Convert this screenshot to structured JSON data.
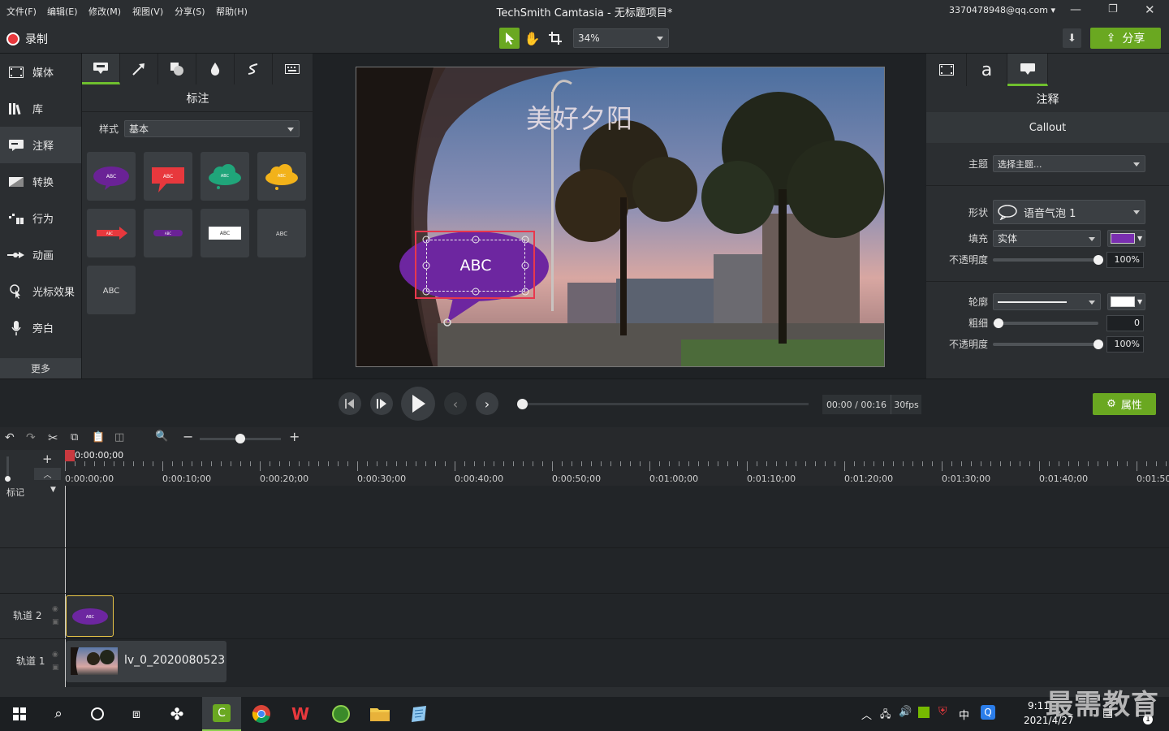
{
  "menubar": {
    "items": [
      "文件(F)",
      "编辑(E)",
      "修改(M)",
      "视图(V)",
      "分享(S)",
      "帮助(H)"
    ],
    "title": "TechSmith Camtasia - 无标题项目*",
    "account": "3370478948@qq.com"
  },
  "toolbar": {
    "record_label": "录制",
    "zoom": "34%",
    "share_label": "分享"
  },
  "leftnav": {
    "items": [
      {
        "label": "媒体",
        "icon": "film-icon"
      },
      {
        "label": "库",
        "icon": "library-icon"
      },
      {
        "label": "注释",
        "icon": "annotation-icon"
      },
      {
        "label": "转换",
        "icon": "transition-icon"
      },
      {
        "label": "行为",
        "icon": "behavior-icon"
      },
      {
        "label": "动画",
        "icon": "animation-icon"
      },
      {
        "label": "光标效果",
        "icon": "cursor-effect-icon"
      },
      {
        "label": "旁白",
        "icon": "microphone-icon"
      }
    ],
    "more_label": "更多"
  },
  "panel": {
    "title": "标注",
    "style_label": "样式",
    "style_value": "基本",
    "tile_text": "ABC"
  },
  "preview": {
    "overlay_text": "美好夕阳",
    "callout_text": "ABC"
  },
  "rightpanel": {
    "title": "注释",
    "subtitle": "Callout",
    "theme_label": "主题",
    "theme_value": "选择主题...",
    "shape_label": "形状",
    "shape_value": "语音气泡 1",
    "fill_label": "填充",
    "fill_value": "实体",
    "fill_color": "#7a2fb0",
    "opacity_label": "不透明度",
    "opacity_value": "100%",
    "opacity_level": 1.0,
    "outline_label": "轮廓",
    "outline_color": "#ffffff",
    "thickness_label": "粗细",
    "thickness_value": "0",
    "outline_opacity_label": "不透明度",
    "outline_opacity_value": "100%",
    "outline_opacity_level": 1.0
  },
  "transport": {
    "time": "00:00 / 00:16",
    "fps": "30fps",
    "properties_label": "属性"
  },
  "timeline": {
    "playhead": "0:00:00;00",
    "ticks": [
      "0:00:00;00",
      "0:00:10;00",
      "0:00:20;00",
      "0:00:30;00",
      "0:00:40;00",
      "0:00:50;00",
      "0:01:00;00",
      "0:01:10;00",
      "0:01:20;00",
      "0:01:30;00",
      "0:01:40;00",
      "0:01:50;"
    ],
    "marker_label": "标记",
    "track2_label": "轨道 2",
    "track1_label": "轨道 1",
    "clip_callout_text": "ABC",
    "clip_video_name": "lv_0_2020080523"
  },
  "taskbar": {
    "time": "9:11",
    "date": "2021/4/27",
    "ime": "中",
    "notification_count": "1"
  },
  "watermark": "最需教育"
}
